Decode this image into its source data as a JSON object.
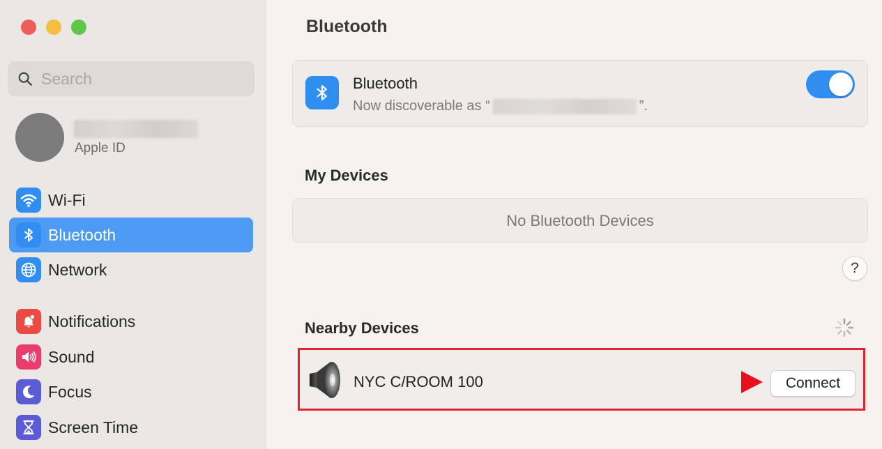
{
  "sidebar": {
    "search": {
      "placeholder": "Search"
    },
    "account": {
      "label": "Apple ID"
    },
    "items": [
      {
        "label": "Wi-Fi",
        "icon": "wifi-icon",
        "color": "#2f8ef0"
      },
      {
        "label": "Bluetooth",
        "icon": "bluetooth-icon",
        "color": "#2f8ef0",
        "active": true
      },
      {
        "label": "Network",
        "icon": "globe-icon",
        "color": "#2f8ef0"
      },
      {
        "label": "Notifications",
        "icon": "bell-icon",
        "color": "#ec4b44"
      },
      {
        "label": "Sound",
        "icon": "speaker-icon",
        "color": "#ec3c6c"
      },
      {
        "label": "Focus",
        "icon": "moon-icon",
        "color": "#5b5bd6"
      },
      {
        "label": "Screen Time",
        "icon": "hourglass-icon",
        "color": "#5b5bd6"
      }
    ]
  },
  "main": {
    "title": "Bluetooth",
    "bluetooth_card": {
      "title": "Bluetooth",
      "status_prefix": "Now discoverable as “",
      "status_suffix": "”.",
      "enabled": true
    },
    "my_devices": {
      "title": "My Devices",
      "empty_text": "No Bluetooth Devices"
    },
    "help_label": "?",
    "nearby_devices": {
      "title": "Nearby Devices",
      "devices": [
        {
          "name": "NYC C/ROOM 100",
          "action": "Connect",
          "icon": "speaker-icon"
        }
      ]
    }
  },
  "colors": {
    "accent": "#2f8ef0",
    "sidebar_selection": "#4c9af4",
    "highlight_border": "#e0242b",
    "arrow": "#e8101c"
  }
}
